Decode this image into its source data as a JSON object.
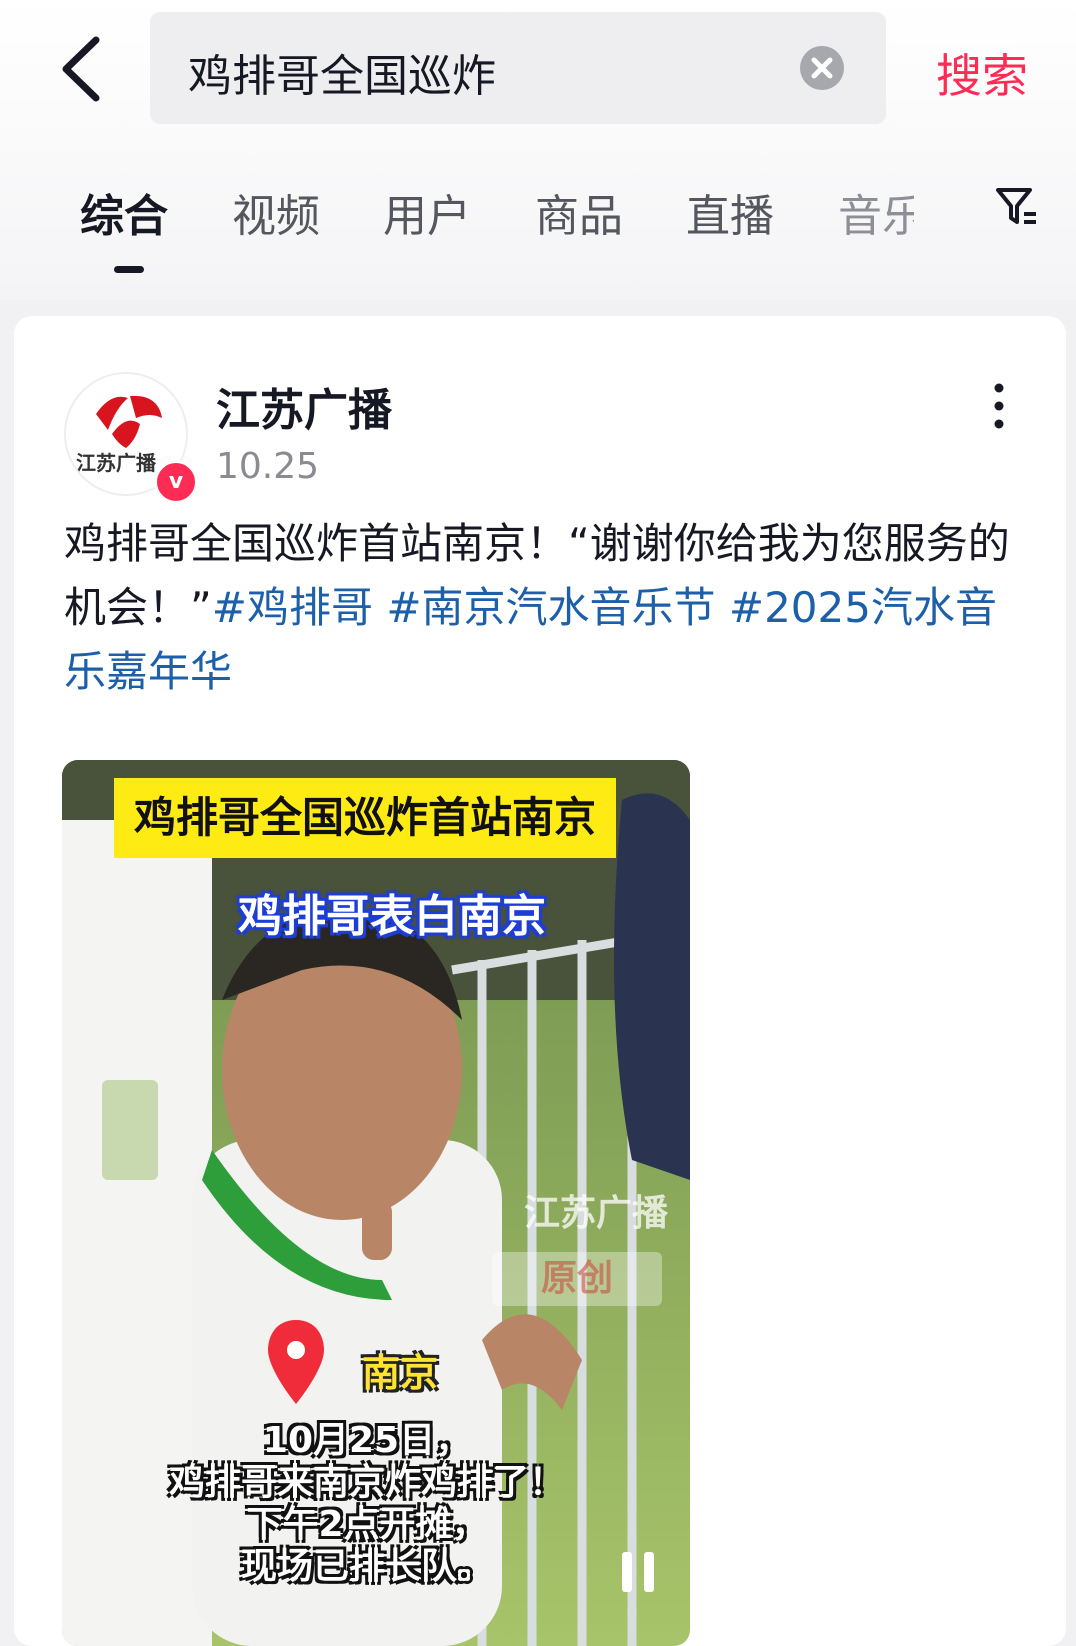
{
  "search": {
    "query": "鸡排哥全国巡炸",
    "submit_label": "搜索"
  },
  "tabs": [
    "综合",
    "视频",
    "用户",
    "商品",
    "直播",
    "音乐"
  ],
  "post": {
    "author": "江苏广播",
    "date": "10.25",
    "avatar_text": "江苏广播",
    "desc_text": "鸡排哥全国巡炸首站南京！“谢谢你给我为您服务的机会！”",
    "hashtags": [
      "#鸡排哥",
      "#南京汽水音乐节",
      "#2025汽水音乐嘉年华"
    ]
  },
  "video": {
    "title_banner": "鸡排哥全国巡炸首站南京",
    "subtitle": "鸡排哥表白南京",
    "location": "南京",
    "watermark": "江苏广播",
    "watermark_stamp": "原创",
    "caption_lines": [
      "10月25日，",
      "鸡排哥来南京炸鸡排了！",
      "下午2点开摊，",
      "现场已排长队。"
    ]
  },
  "colors": {
    "accent": "#fe2c55",
    "hashtag": "#1d5fa9",
    "title_banner": "#ffeb14"
  }
}
